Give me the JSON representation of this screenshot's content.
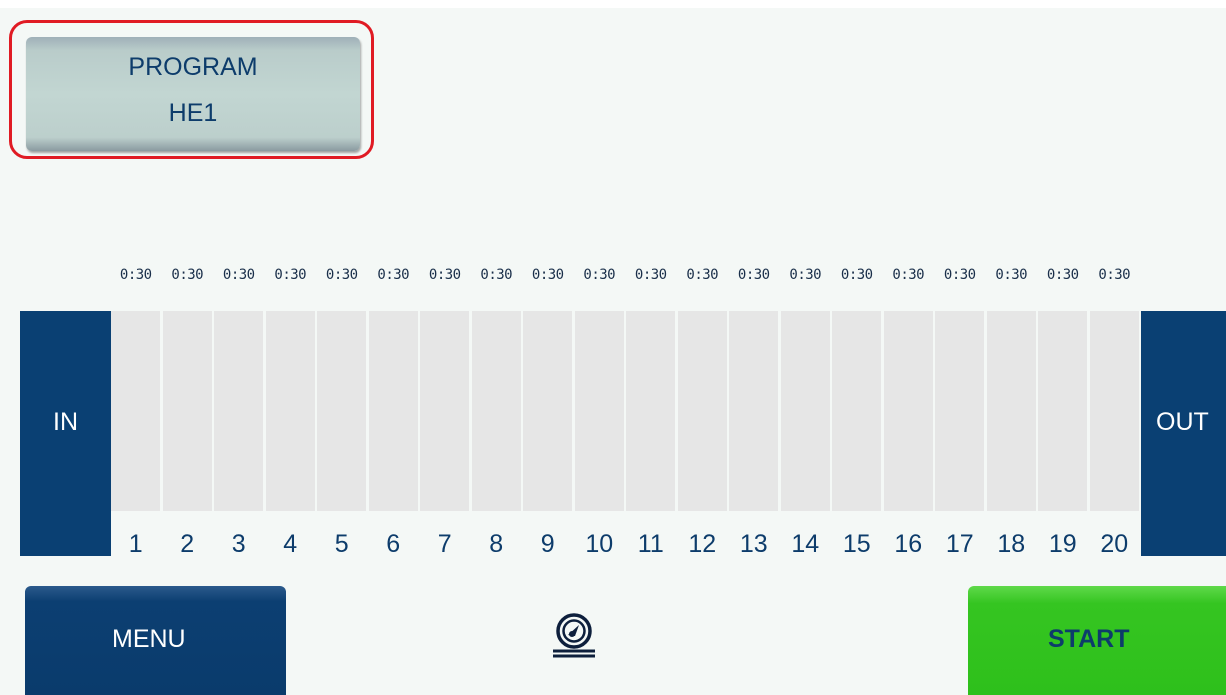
{
  "program": {
    "title": "PROGRAM",
    "name": "HE1"
  },
  "conveyor": {
    "in_label": "IN",
    "out_label": "OUT",
    "stations": [
      {
        "number": "1",
        "time": "0:30"
      },
      {
        "number": "2",
        "time": "0:30"
      },
      {
        "number": "3",
        "time": "0:30"
      },
      {
        "number": "4",
        "time": "0:30"
      },
      {
        "number": "5",
        "time": "0:30"
      },
      {
        "number": "6",
        "time": "0:30"
      },
      {
        "number": "7",
        "time": "0:30"
      },
      {
        "number": "8",
        "time": "0:30"
      },
      {
        "number": "9",
        "time": "0:30"
      },
      {
        "number": "10",
        "time": "0:30"
      },
      {
        "number": "11",
        "time": "0:30"
      },
      {
        "number": "12",
        "time": "0:30"
      },
      {
        "number": "13",
        "time": "0:30"
      },
      {
        "number": "14",
        "time": "0:30"
      },
      {
        "number": "15",
        "time": "0:30"
      },
      {
        "number": "16",
        "time": "0:30"
      },
      {
        "number": "17",
        "time": "0:30"
      },
      {
        "number": "18",
        "time": "0:30"
      },
      {
        "number": "19",
        "time": "0:30"
      },
      {
        "number": "20",
        "time": "0:30"
      }
    ]
  },
  "footer": {
    "menu_label": "MENU",
    "start_label": "START",
    "center_icon": "pressure-gauge-icon"
  },
  "colors": {
    "background": "#f4f8f6",
    "navy": "#0a4073",
    "text_navy": "#0d3c6b",
    "start_green": "#2ec01b",
    "highlight_red": "#e01b24",
    "slot_gray": "#e6e6e6",
    "program_button": "#c2d6d2"
  }
}
